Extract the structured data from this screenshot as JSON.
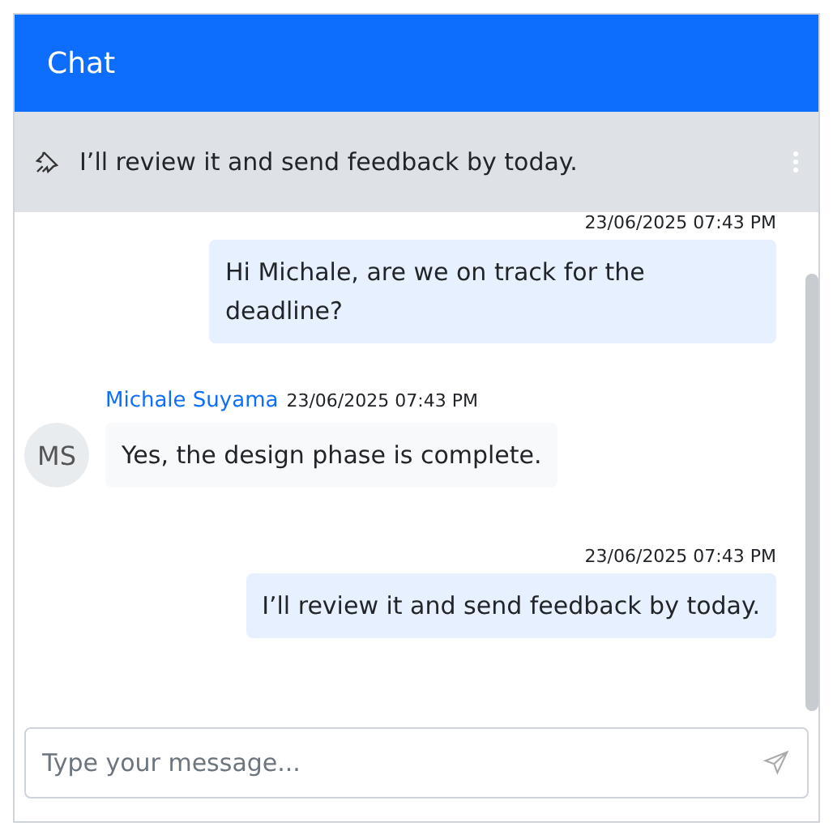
{
  "header": {
    "title": "Chat"
  },
  "pinned": {
    "text": "I’ll review it and send feedback by today."
  },
  "messages": [
    {
      "kind": "outgoing",
      "time": "23/06/2025 07:43 PM",
      "text": "Hi Michale, are we on track for the deadline?"
    },
    {
      "kind": "incoming",
      "author": "Michale Suyama",
      "initials": "MS",
      "time": "23/06/2025 07:43 PM",
      "text": "Yes, the design phase is complete."
    },
    {
      "kind": "outgoing",
      "time": "23/06/2025 07:43 PM",
      "text": "I’ll review it and send feedback by today."
    }
  ],
  "composer": {
    "placeholder": "Type your message..."
  }
}
